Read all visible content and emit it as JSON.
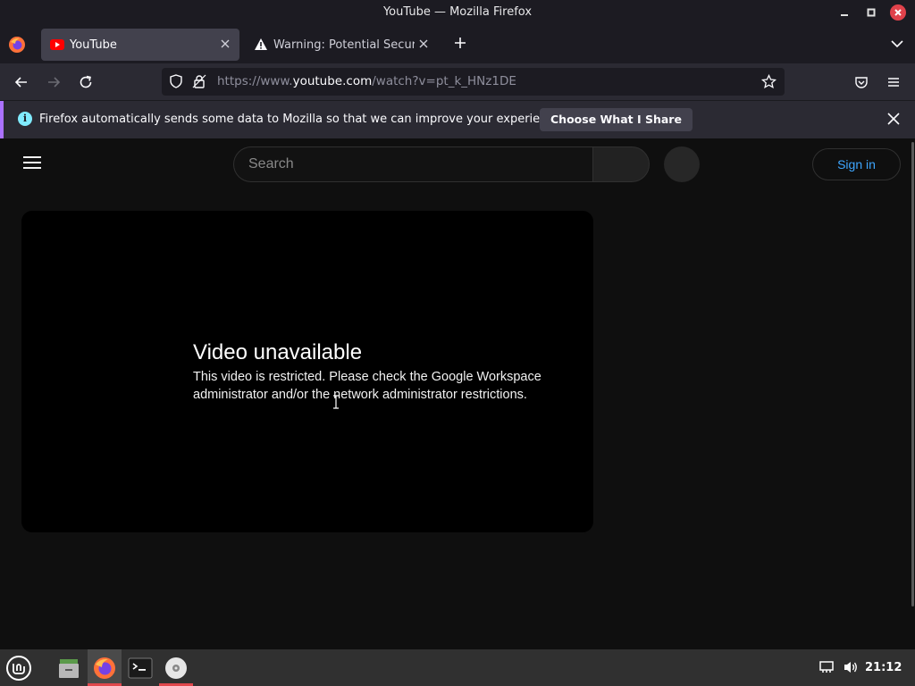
{
  "window": {
    "title": "YouTube — Mozilla Firefox"
  },
  "tabs": [
    {
      "label": "YouTube",
      "favicon": "youtube-icon",
      "active": true
    },
    {
      "label": "Warning: Potential Security Risk Ahead",
      "favicon": "warning-icon",
      "active": false
    }
  ],
  "urlbar": {
    "url_prefix": "https://www.",
    "url_host": "youtube.com",
    "url_path": "/watch?v=pt_k_HNz1DE"
  },
  "notification": {
    "message": "Firefox automatically sends some data to Mozilla so that we can improve your experience.",
    "button_label": "Choose What I Share"
  },
  "youtube": {
    "search_placeholder": "Search",
    "signin_label": "Sign in",
    "video_error_title": "Video unavailable",
    "video_error_message": "This video is restricted. Please check the Google Workspace administrator and/or the network administrator restrictions."
  },
  "taskbar": {
    "apps": [
      "mint-menu-icon",
      "files-icon",
      "firefox-icon",
      "terminal-icon",
      "disc-icon"
    ],
    "clock": "21:12"
  },
  "colors": {
    "accent_link": "#3ea6ff",
    "notification_stripe": "#ab71ff",
    "taskbar_active": "#e0474c"
  }
}
